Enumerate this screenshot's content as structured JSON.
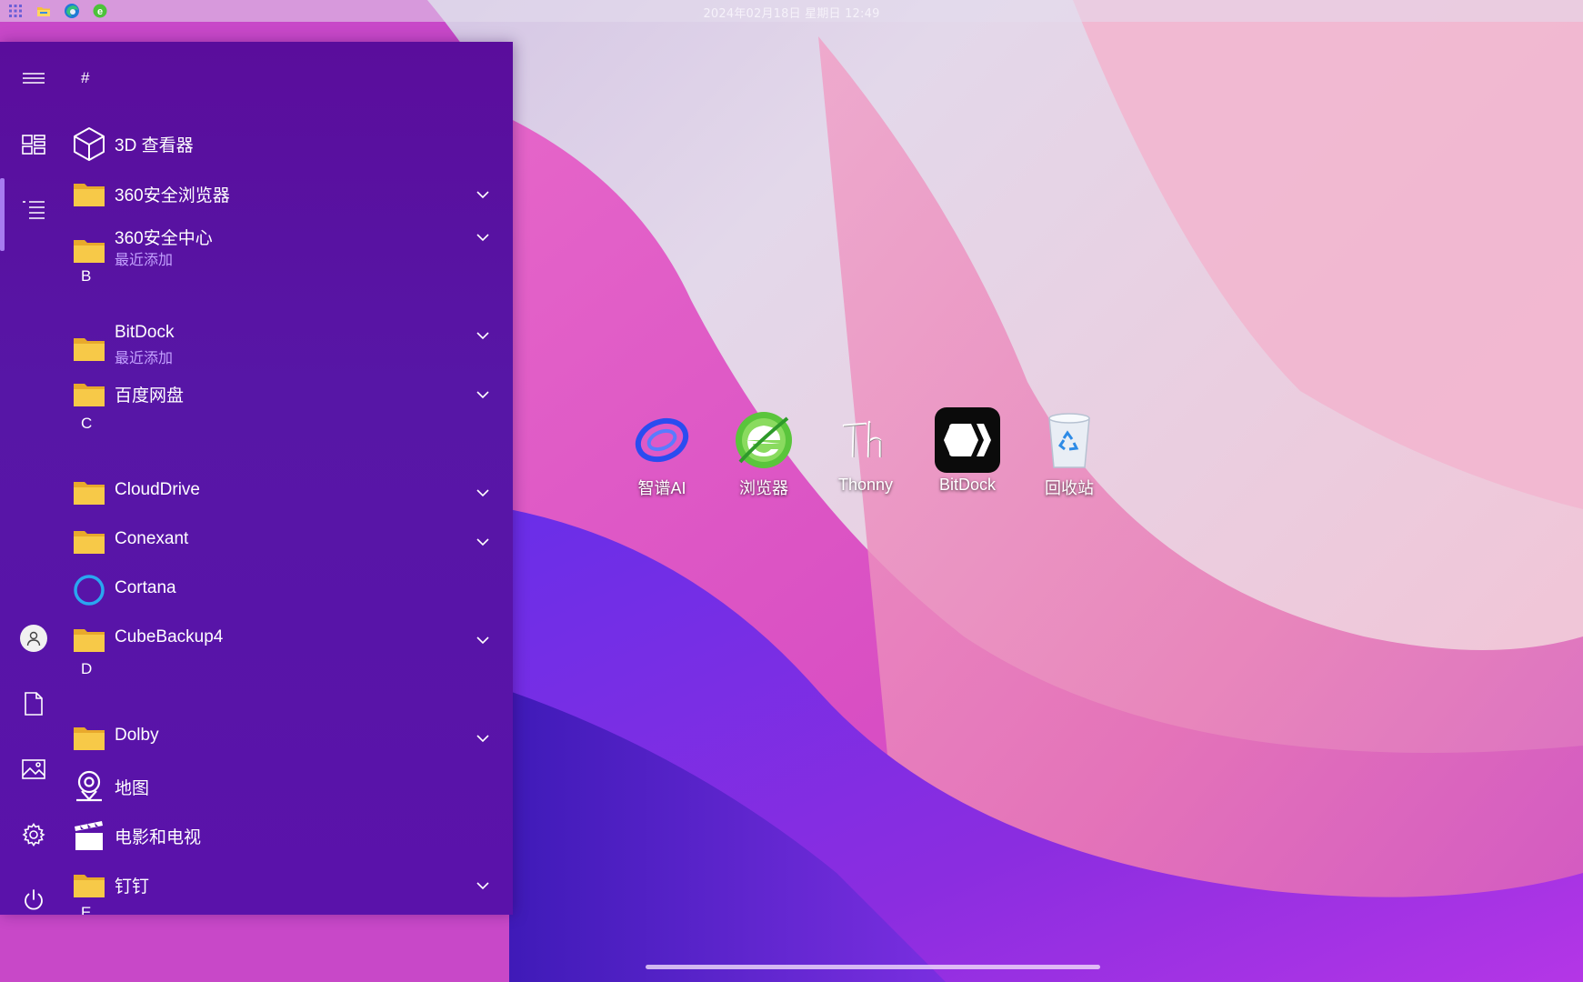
{
  "topbar": {
    "clock": "2024年02月18日 星期日 12:49",
    "icons": [
      "apps-grid-icon",
      "file-explorer-icon",
      "edge-browser-icon",
      "360-browser-icon"
    ]
  },
  "start_menu": {
    "rail": {
      "items": [
        {
          "name": "menu-icon"
        },
        {
          "name": "tiles-icon"
        },
        {
          "name": "all-apps-list-icon",
          "active": true
        },
        {
          "name": "user-icon"
        },
        {
          "name": "documents-icon"
        },
        {
          "name": "pictures-icon"
        },
        {
          "name": "settings-icon"
        },
        {
          "name": "power-icon"
        }
      ]
    },
    "groups": [
      {
        "header": "#"
      },
      {
        "header": "B"
      },
      {
        "header": "C"
      },
      {
        "header": "D"
      },
      {
        "header": "E"
      }
    ],
    "apps": [
      {
        "label": "3D 查看器",
        "icon": "cube-icon"
      },
      {
        "label": "360安全浏览器",
        "icon": "folder-icon",
        "expandable": true
      },
      {
        "label": "360安全中心",
        "sublabel": "最近添加",
        "icon": "folder-icon",
        "expandable": true
      },
      {
        "label": "BitDock",
        "sublabel": "最近添加",
        "icon": "folder-icon",
        "expandable": true
      },
      {
        "label": "百度网盘",
        "icon": "folder-icon",
        "expandable": true
      },
      {
        "label": "CloudDrive",
        "icon": "folder-icon",
        "expandable": true
      },
      {
        "label": "Conexant",
        "icon": "folder-icon",
        "expandable": true
      },
      {
        "label": "Cortana",
        "icon": "cortana-icon"
      },
      {
        "label": "CubeBackup4",
        "icon": "folder-icon",
        "expandable": true
      },
      {
        "label": "Dolby",
        "icon": "folder-icon",
        "expandable": true
      },
      {
        "label": "地图",
        "icon": "maps-icon"
      },
      {
        "label": "电影和电视",
        "icon": "movies-icon"
      },
      {
        "label": "钉钉",
        "icon": "folder-icon",
        "expandable": true
      }
    ]
  },
  "desktop": {
    "icons": [
      {
        "label": "智谱AI",
        "icon": "zhipu-ai-icon"
      },
      {
        "label": "浏览器",
        "icon": "browser-icon"
      },
      {
        "label": "Thonny",
        "icon": "thonny-icon"
      },
      {
        "label": "BitDock",
        "icon": "bitdock-icon"
      },
      {
        "label": "回收站",
        "icon": "recycle-bin-icon"
      }
    ]
  },
  "colors": {
    "menu_bg": "#5716a6",
    "accent": "#a77cf0",
    "sublabel": "#c4a2ff",
    "folder": "#f7c948"
  }
}
